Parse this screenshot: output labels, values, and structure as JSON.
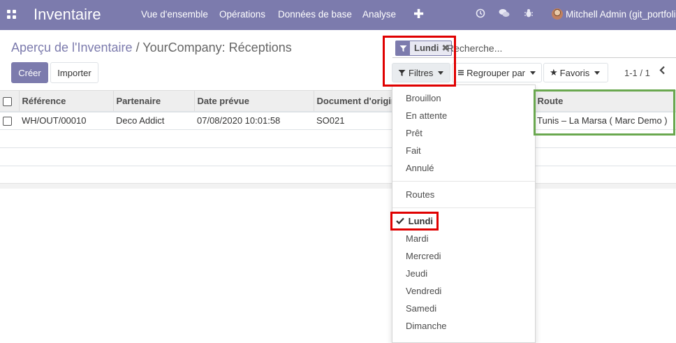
{
  "app": {
    "title": "Inventaire",
    "menu": [
      "Vue d'ensemble",
      "Opérations",
      "Données de base",
      "Analyse"
    ],
    "user": "Mitchell Admin (git_portfolio",
    "brand_color": "#7c7bad"
  },
  "breadcrumb": {
    "parent": "Aperçu de l'Inventaire",
    "separator": "/",
    "current": "YourCompany: Réceptions"
  },
  "buttons": {
    "create": "Créer",
    "import": "Importer"
  },
  "search": {
    "facet_label": "Lundi",
    "placeholder": "Recherche..."
  },
  "toolbar": {
    "filters": "Filtres",
    "group_by": "Regrouper par",
    "favorites": "Favoris",
    "pager": "1-1 / 1"
  },
  "table": {
    "columns": [
      "Référence",
      "Partenaire",
      "Date prévue",
      "Document d'origine",
      "Route"
    ],
    "rows": [
      {
        "reference": "WH/OUT/00010",
        "partner": "Deco Addict",
        "scheduled_date": "07/08/2020 10:01:58",
        "source_document": "SO021",
        "route": "Tunis – La Marsa ( Marc Demo )"
      }
    ]
  },
  "filters_dropdown": {
    "status": [
      "Brouillon",
      "En attente",
      "Prêt",
      "Fait",
      "Annulé"
    ],
    "routes": "Routes",
    "days": [
      "Lundi",
      "Mardi",
      "Mercredi",
      "Jeudi",
      "Vendredi",
      "Samedi",
      "Dimanche"
    ],
    "selected": "Lundi"
  }
}
